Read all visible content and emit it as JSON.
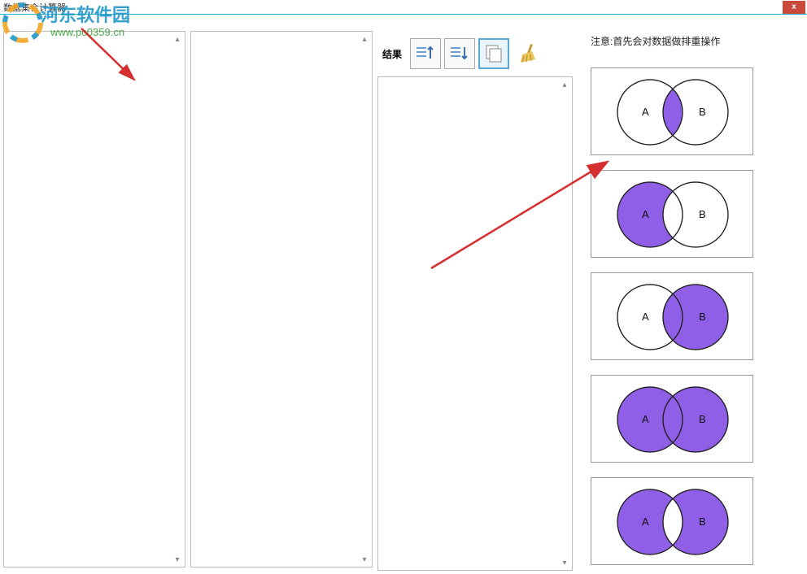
{
  "window": {
    "title": "数据集合计算器",
    "close_label": "x"
  },
  "watermark": {
    "text_main": "河东软件园",
    "text_url": "www.pc0359.cn"
  },
  "result": {
    "label": "结果",
    "toolbar": {
      "sort_asc": "sort-asc",
      "sort_desc": "sort-desc",
      "copy": "copy",
      "clear": "clear"
    }
  },
  "note": "注意:首先会对数据做排重操作",
  "venn": {
    "labelA": "A",
    "labelB": "B",
    "fill": "#8f5fe8",
    "operations": [
      {
        "id": "intersection",
        "fillA": false,
        "fillB": false,
        "fillInter": true
      },
      {
        "id": "a-minus-b",
        "fillA": true,
        "fillB": false,
        "fillInter": false
      },
      {
        "id": "b-minus-a",
        "fillA": false,
        "fillB": true,
        "fillInter": true
      },
      {
        "id": "union",
        "fillA": true,
        "fillB": true,
        "fillInter": true
      },
      {
        "id": "sym-diff",
        "fillA": true,
        "fillB": true,
        "fillInter": false
      }
    ]
  },
  "inputs": {
    "setA": "",
    "setB": "",
    "resultText": ""
  }
}
